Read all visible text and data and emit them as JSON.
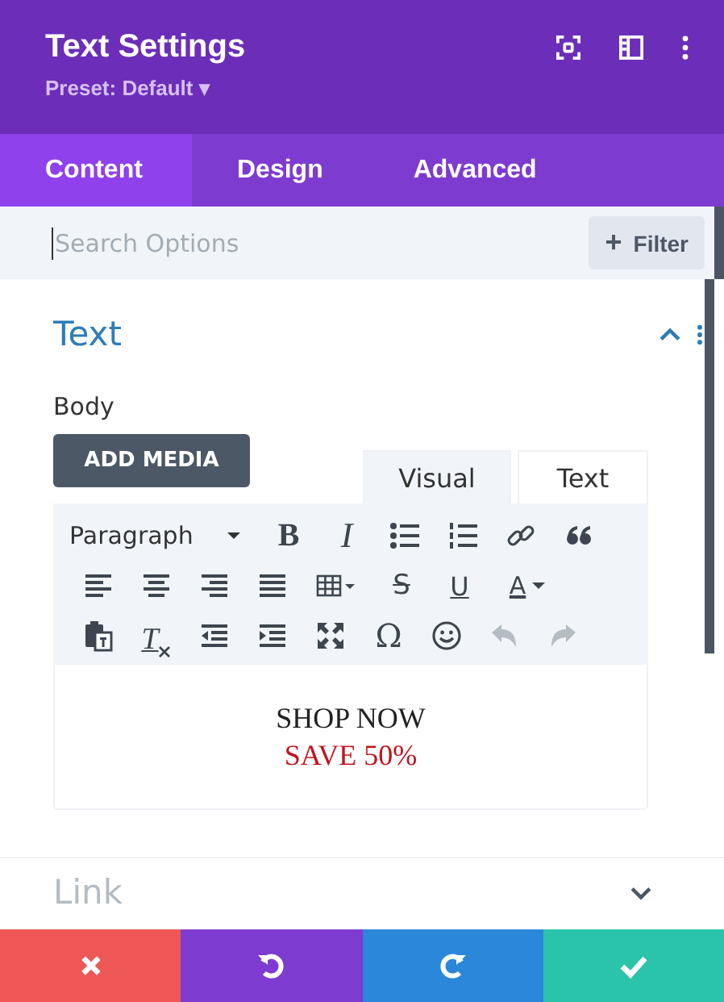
{
  "header": {
    "title": "Text Settings",
    "preset": "Preset: Default",
    "preset_caret": "▾"
  },
  "tabs": [
    {
      "label": "Content",
      "selected": true
    },
    {
      "label": "Design",
      "selected": false
    },
    {
      "label": "Advanced",
      "selected": false
    }
  ],
  "search": {
    "placeholder": "Search Options",
    "filter_label": "Filter",
    "filter_plus": "+"
  },
  "section": {
    "title": "Text",
    "expanded": true,
    "field_label": "Body",
    "add_media": "ADD MEDIA",
    "editor_tabs": [
      {
        "label": "Visual",
        "selected": true
      },
      {
        "label": "Text",
        "selected": false
      }
    ],
    "toolbar": {
      "buttons": [
        {
          "kind": "format-select",
          "label": "Paragraph",
          "disabled": false
        },
        {
          "kind": "bold",
          "label": "B",
          "disabled": false
        },
        {
          "kind": "italic",
          "label": "I",
          "disabled": false
        },
        {
          "kind": "bullet-list",
          "disabled": false
        },
        {
          "kind": "number-list",
          "disabled": false
        },
        {
          "kind": "link",
          "disabled": false
        },
        {
          "kind": "quote",
          "disabled": false
        },
        {
          "kind": "align-left",
          "disabled": false
        },
        {
          "kind": "align-center",
          "disabled": false
        },
        {
          "kind": "align-right",
          "disabled": false
        },
        {
          "kind": "justify",
          "disabled": false
        },
        {
          "kind": "table",
          "disabled": false
        },
        {
          "kind": "strikethrough",
          "label": "S",
          "disabled": false
        },
        {
          "kind": "underline",
          "label": "U",
          "disabled": false
        },
        {
          "kind": "text-color",
          "label": "A",
          "disabled": false
        },
        {
          "kind": "paste-text",
          "disabled": false
        },
        {
          "kind": "clear-format",
          "label": "T",
          "disabled": false
        },
        {
          "kind": "outdent",
          "disabled": false
        },
        {
          "kind": "indent",
          "disabled": false
        },
        {
          "kind": "fullscreen",
          "disabled": false
        },
        {
          "kind": "special-char",
          "label": "Ω",
          "disabled": false
        },
        {
          "kind": "emoji",
          "disabled": false
        },
        {
          "kind": "undo",
          "disabled": true
        },
        {
          "kind": "redo",
          "disabled": true
        }
      ]
    },
    "content": [
      {
        "text": "SHOP NOW",
        "color": "#222222"
      },
      {
        "text": "SAVE 50%",
        "color": "#c0141c"
      }
    ]
  },
  "next_section": {
    "title": "Link"
  },
  "footer": [
    {
      "kind": "discard",
      "color": "#ef5656"
    },
    {
      "kind": "undo",
      "color": "#7e3bd0"
    },
    {
      "kind": "redo",
      "color": "#2b87da"
    },
    {
      "kind": "save",
      "color": "#29c4a9"
    }
  ]
}
